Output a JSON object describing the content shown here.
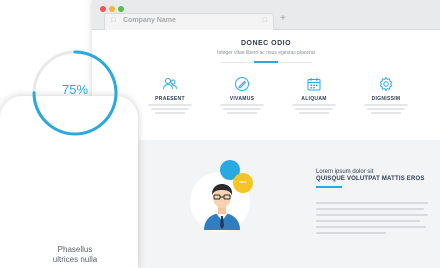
{
  "browser": {
    "tab_title": "Company Name",
    "new_tab_label": "+",
    "tab_glyph": "□",
    "tab_close_glyph": "□"
  },
  "hero": {
    "title": "DONEC ODIO",
    "subtitle": "Integer vitae libero ac risus egestas placerat"
  },
  "features": [
    {
      "label": "PRAESENT",
      "icon": "users-icon"
    },
    {
      "label": "VIVAMUS",
      "icon": "pen-tool-icon"
    },
    {
      "label": "ALIQUAM",
      "icon": "calendar-icon"
    },
    {
      "label": "DIGNISSIM",
      "icon": "gear-icon"
    }
  ],
  "story": {
    "kicker": "Lorem ipsum dolor sit",
    "title": "QUISQUE VOLUTPAT MATTIS EROS",
    "badge_text": "IDEA"
  },
  "gauge": {
    "value_text": "75%",
    "value": 0.75,
    "label_line1": "Phasellus",
    "label_line2": "ultrices nulla"
  },
  "colors": {
    "accent_blue": "#2aa9e0",
    "accent_yellow": "#f5c425",
    "track_gray": "#e6e8ea"
  }
}
